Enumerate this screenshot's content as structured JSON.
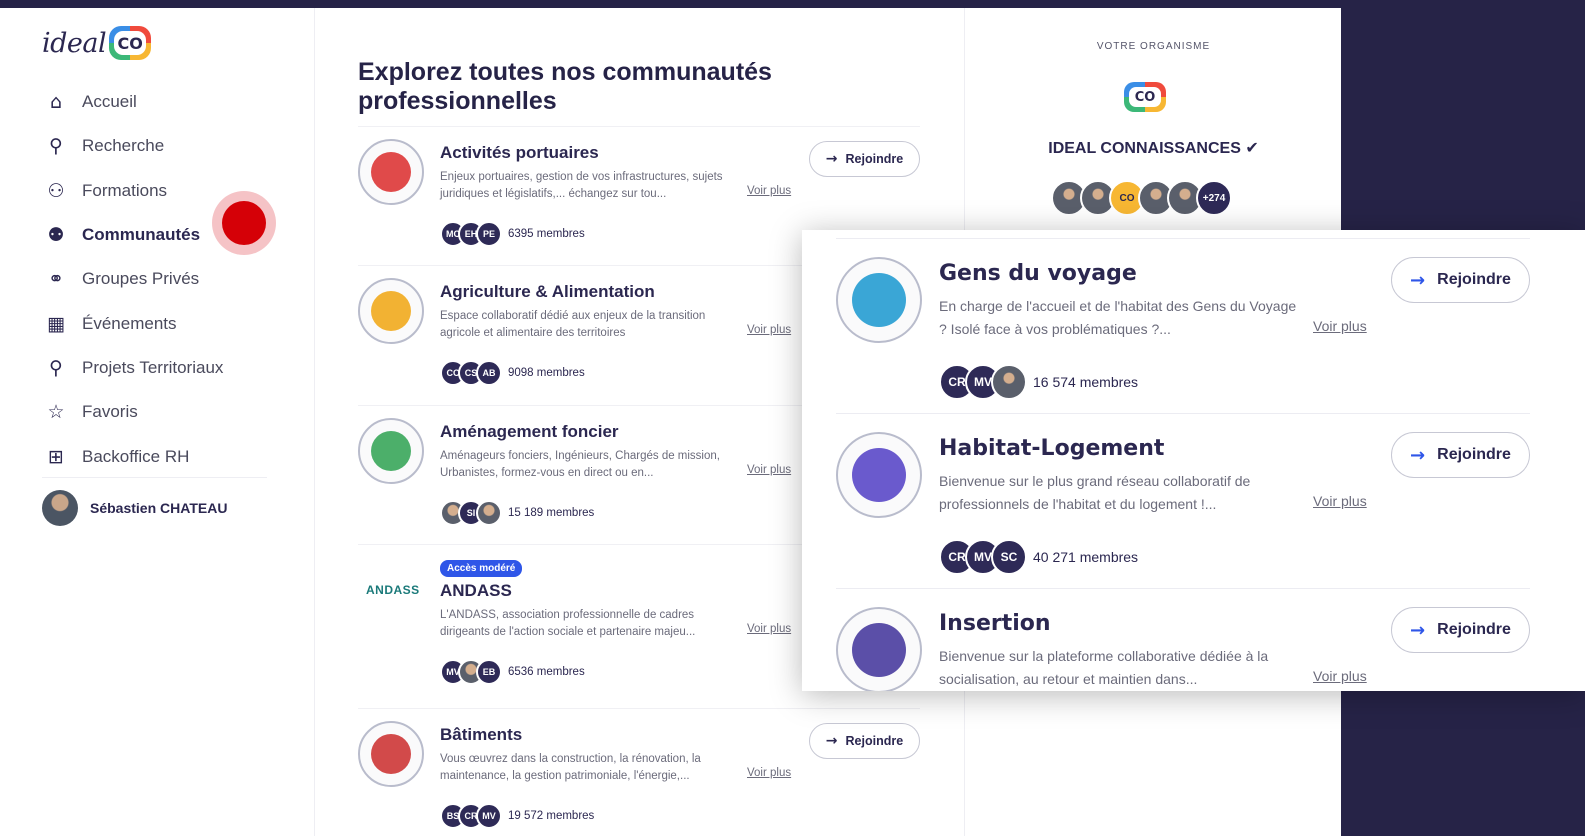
{
  "logo": {
    "text": "ideal",
    "badge": "CO"
  },
  "nav": [
    {
      "label": "Accueil",
      "icon": "home-icon",
      "glyph": "⌂"
    },
    {
      "label": "Recherche",
      "icon": "search-icon",
      "glyph": "⚲"
    },
    {
      "label": "Formations",
      "icon": "formations-icon",
      "glyph": "⚇"
    },
    {
      "label": "Communautés",
      "icon": "communities-icon",
      "glyph": "⚉"
    },
    {
      "label": "Groupes Privés",
      "icon": "private-groups-icon",
      "glyph": "⚭"
    },
    {
      "label": "Événements",
      "icon": "calendar-icon",
      "glyph": "▦"
    },
    {
      "label": "Projets Territoriaux",
      "icon": "pin-icon",
      "glyph": "⚲"
    },
    {
      "label": "Favoris",
      "icon": "star-icon",
      "glyph": "☆"
    },
    {
      "label": "Backoffice RH",
      "icon": "layout-icon",
      "glyph": "⊞"
    }
  ],
  "user": {
    "name": "Sébastien CHATEAU"
  },
  "main": {
    "title": "Explorez toutes nos communautés professionnelles",
    "join_label": "Rejoindre",
    "more_label": "Voir plus",
    "rows": [
      {
        "name": "Activités portuaires",
        "desc": "Enjeux portuaires, gestion de vos infrastructures, sujets juridiques et législatifs,... échangez sur tou...",
        "avatars": [
          "MC",
          "EH",
          "PE"
        ],
        "members": "6395 membres",
        "icon_color": "#e04a4a"
      },
      {
        "name": "Agriculture & Alimentation",
        "desc": "Espace collaboratif dédié aux enjeux de la transition agricole et alimentaire des territoires",
        "avatars": [
          "CC",
          "CS",
          "AB"
        ],
        "members": "9098 membres",
        "icon_color": "#f2b233"
      },
      {
        "name": "Aménagement foncier",
        "desc": "Aménageurs fonciers, Ingénieurs, Chargés de mission, Urbanistes, formez-vous en direct ou en...",
        "avatars": [
          "",
          "SI",
          ""
        ],
        "members": "15 189 membres",
        "icon_color": "#4caf6a"
      },
      {
        "name": "ANDASS",
        "badge": "Accès modéré",
        "logo": "ANDASS",
        "desc": "L'ANDASS, association professionnelle de cadres dirigeants de l'action sociale et partenaire majeu...",
        "avatars": [
          "MV",
          "",
          "EB"
        ],
        "members": "6536 membres"
      },
      {
        "name": "Bâtiments",
        "desc": "Vous œuvrez dans la construction, la rénovation, la maintenance, la gestion patrimoniale, l'énergie,...",
        "avatars": [
          "BS",
          "CR",
          "MV"
        ],
        "members": "19 572 membres",
        "icon_color": "#d24a4a"
      }
    ]
  },
  "org": {
    "label": "VOTRE ORGANISME",
    "logo": "CO",
    "name": "IDEAL CONNAISSANCES",
    "extra": "+274"
  },
  "zoom": {
    "rows": [
      {
        "name": "Gens du voyage",
        "desc": "En charge de l'accueil et de l'habitat des Gens du Voyage ? Isolé face à vos problématiques ?...",
        "avatars": [
          "CR",
          "MV",
          ""
        ],
        "members": "16 574 membres",
        "icon_color": "#3aa6d6"
      },
      {
        "name": "Habitat-Logement",
        "desc": "Bienvenue sur le plus grand réseau collaboratif de professionnels de l'habitat et du logement !...",
        "avatars": [
          "CR",
          "MV",
          "SC"
        ],
        "members": "40 271 membres",
        "icon_color": "#6a5acd"
      },
      {
        "name": "Insertion",
        "desc": "Bienvenue sur la plateforme collaborative dédiée à la socialisation, au retour et maintien dans...",
        "avatars": [],
        "members": "",
        "icon_color": "#5b4fa8"
      }
    ]
  }
}
